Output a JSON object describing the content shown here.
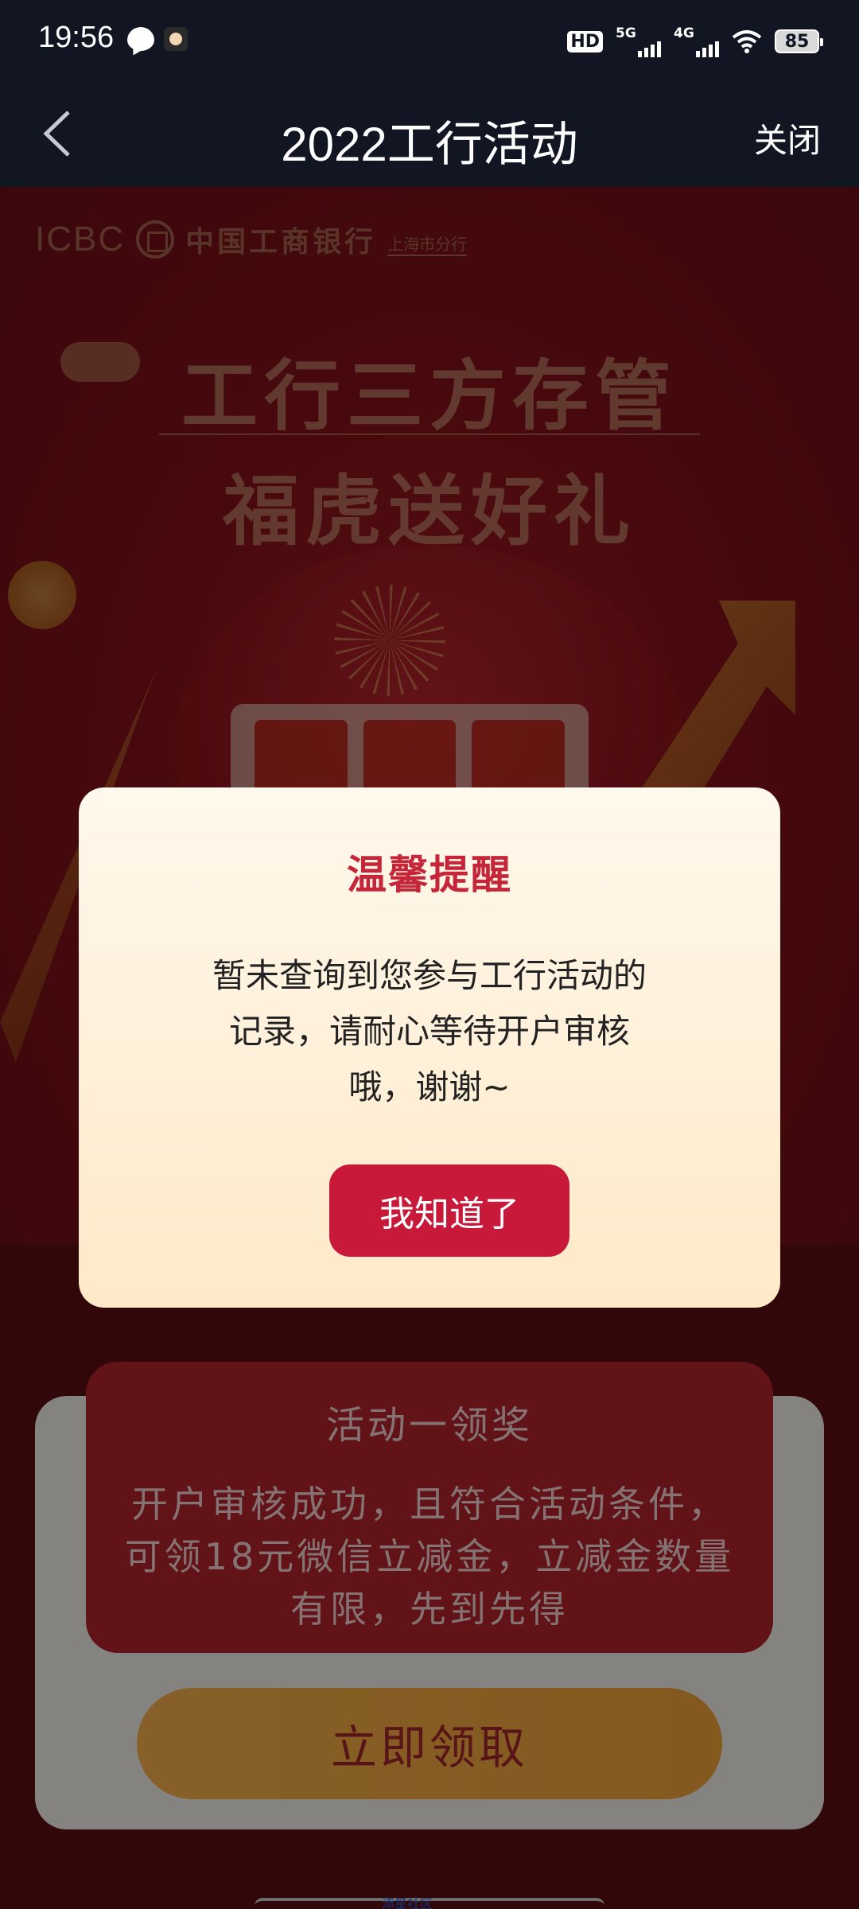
{
  "status_bar": {
    "time": "19:56",
    "hd_label": "HD",
    "net1_label": "5G",
    "net2_label": "4G",
    "battery": "85",
    "icons": [
      "message-icon",
      "app-icon",
      "hd-icon",
      "signal-5g-icon",
      "signal-4g-icon",
      "wifi-icon",
      "battery-icon"
    ]
  },
  "nav": {
    "title": "2022工行活动",
    "close_label": "关闭",
    "back_icon": "chevron-left-icon"
  },
  "poster": {
    "logo_text": "ICBC",
    "bank_name": "中国工商银行",
    "branch": "上海市分行",
    "headline_1": "工行三方存管",
    "headline_2": "福虎送好礼"
  },
  "modal": {
    "title": "温馨提醒",
    "body_lines": [
      "暂未查询到您参与工行活动的",
      "记录，请耐心等待开户审核",
      "哦，谢谢~"
    ],
    "ok_label": "我知道了"
  },
  "activity": {
    "title": "活动一领奖",
    "desc": "开户审核成功，且符合活动条件，可领18元微信立减金，立减金数量有限，先到先得",
    "claim_label": "立即领取"
  },
  "footer": {
    "text": "添星社区"
  },
  "colors": {
    "bar_bg": "#111622",
    "modal_accent": "#c9193a",
    "title_red": "#c6263a",
    "claim_orange": "#f4b04a"
  }
}
